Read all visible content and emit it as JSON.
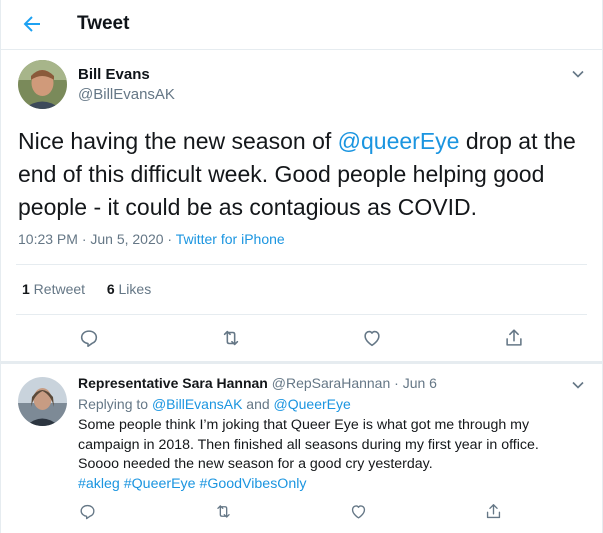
{
  "header": {
    "title": "Tweet",
    "back_icon": "arrow-left-icon"
  },
  "tweet": {
    "author_name": "Bill Evans",
    "author_handle": "@BillEvansAK",
    "text_before": "Nice having the new season of ",
    "mention": "@queerEye",
    "text_after": " drop at the end of this difficult week.  Good people helping good people - it could be as contagious as COVID.",
    "time": "10:23 PM · Jun 5, 2020 · ",
    "source": "Twitter for iPhone",
    "retweets_count": "1",
    "retweets_label": " Retweet",
    "likes_count": "6",
    "likes_label": " Likes"
  },
  "reply": {
    "author_name": "Representative Sara Hannan",
    "author_handle": "@RepSaraHannan",
    "date": "Jun 6",
    "replying_prefix": "Replying to ",
    "replying_to_1": "@BillEvansAK",
    "replying_and": " and ",
    "replying_to_2": "@QueerEye",
    "text": "Some people think I’m joking that Queer Eye is what got me through my campaign in 2018. Then finished all seasons during my first year in office. Soooo needed the new season for a good cry yesterday.",
    "hashtags": "#akleg #QueerEye #GoodVibesOnly"
  },
  "colors": {
    "accent": "#1da1f2",
    "link": "#1b95e0",
    "muted": "#657786",
    "border": "#e6ecf0"
  }
}
